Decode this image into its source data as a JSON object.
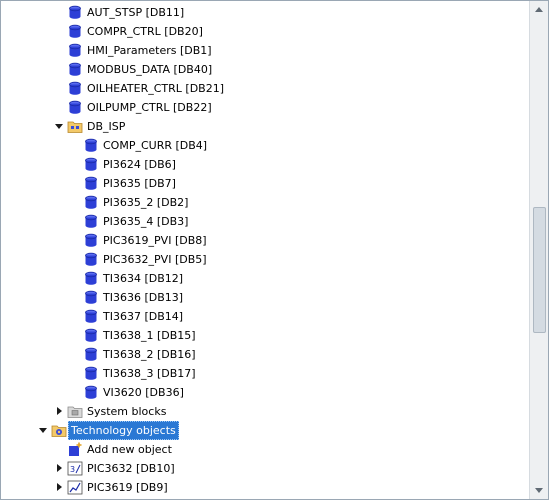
{
  "tree": {
    "rows": [
      {
        "label": "AUT_STSP [DB11]",
        "icon": "data-block-icon"
      },
      {
        "label": "COMPR_CTRL [DB20]",
        "icon": "data-block-icon"
      },
      {
        "label": "HMI_Parameters [DB1]",
        "icon": "data-block-icon"
      },
      {
        "label": "MODBUS_DATA [DB40]",
        "icon": "data-block-icon"
      },
      {
        "label": "OILHEATER_CTRL [DB21]",
        "icon": "data-block-icon"
      },
      {
        "label": "OILPUMP_CTRL [DB22]",
        "icon": "data-block-icon"
      },
      {
        "label": "DB_ISP",
        "icon": "folder-icon",
        "state": "expanded"
      },
      {
        "label": "COMP_CURR [DB4]",
        "icon": "data-block-icon"
      },
      {
        "label": "PI3624 [DB6]",
        "icon": "data-block-icon"
      },
      {
        "label": "PI3635 [DB7]",
        "icon": "data-block-icon"
      },
      {
        "label": "PI3635_2 [DB2]",
        "icon": "data-block-icon"
      },
      {
        "label": "PI3635_4 [DB3]",
        "icon": "data-block-icon"
      },
      {
        "label": "PIC3619_PVI [DB8]",
        "icon": "data-block-icon"
      },
      {
        "label": "PIC3632_PVI [DB5]",
        "icon": "data-block-icon"
      },
      {
        "label": "TI3634 [DB12]",
        "icon": "data-block-icon"
      },
      {
        "label": "TI3636 [DB13]",
        "icon": "data-block-icon"
      },
      {
        "label": "TI3637 [DB14]",
        "icon": "data-block-icon"
      },
      {
        "label": "TI3638_1 [DB15]",
        "icon": "data-block-icon"
      },
      {
        "label": "TI3638_2 [DB16]",
        "icon": "data-block-icon"
      },
      {
        "label": "TI3638_3 [DB17]",
        "icon": "data-block-icon"
      },
      {
        "label": "VI3620 [DB36]",
        "icon": "data-block-icon"
      },
      {
        "label": "System blocks",
        "icon": "system-blocks-icon",
        "state": "collapsed"
      },
      {
        "label": "Technology objects",
        "icon": "technology-objects-icon",
        "state": "expanded",
        "selected": true
      },
      {
        "label": "Add new object",
        "icon": "add-new-object-icon"
      },
      {
        "label": "PIC3632 [DB10]",
        "icon": "pid-controller-icon",
        "state": "collapsed"
      },
      {
        "label": "PIC3619 [DB9]",
        "icon": "pid-trend-icon",
        "state": "collapsed"
      }
    ]
  },
  "colors": {
    "selection": "#2a78d4",
    "db_icon": "#2d3fd6",
    "folder": "#e8b24c"
  }
}
